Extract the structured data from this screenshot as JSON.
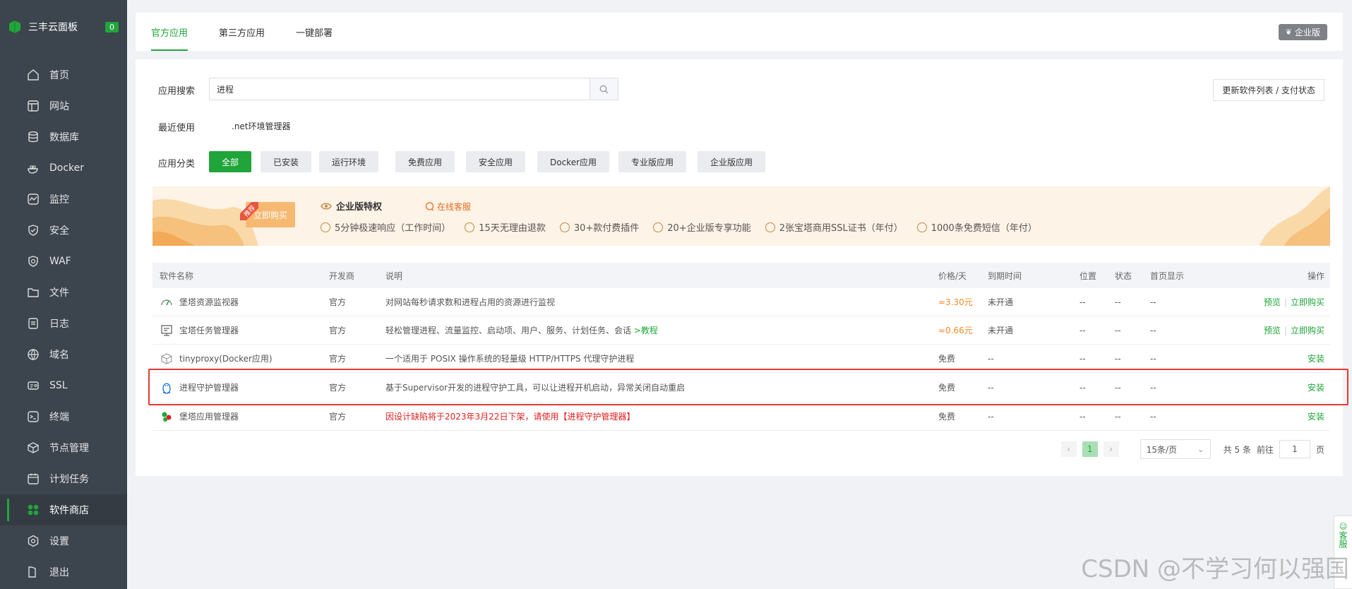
{
  "sidebar": {
    "brand": "三丰云面板",
    "badge": "0",
    "items": [
      {
        "label": "首页",
        "icon": "home-icon"
      },
      {
        "label": "网站",
        "icon": "website-icon"
      },
      {
        "label": "数据库",
        "icon": "database-icon"
      },
      {
        "label": "Docker",
        "icon": "docker-icon"
      },
      {
        "label": "监控",
        "icon": "monitor-icon"
      },
      {
        "label": "安全",
        "icon": "shield-icon"
      },
      {
        "label": "WAF",
        "icon": "waf-icon"
      },
      {
        "label": "文件",
        "icon": "folder-icon"
      },
      {
        "label": "日志",
        "icon": "log-icon"
      },
      {
        "label": "域名",
        "icon": "globe-icon"
      },
      {
        "label": "SSL",
        "icon": "ssl-icon"
      },
      {
        "label": "终端",
        "icon": "terminal-icon"
      },
      {
        "label": "节点管理",
        "icon": "cube-icon"
      },
      {
        "label": "计划任务",
        "icon": "calendar-icon"
      },
      {
        "label": "软件商店",
        "icon": "store-icon",
        "active": true
      },
      {
        "label": "设置",
        "icon": "gear-icon"
      },
      {
        "label": "退出",
        "icon": "logout-icon"
      }
    ]
  },
  "tabs": [
    {
      "label": "官方应用",
      "active": true
    },
    {
      "label": "第三方应用"
    },
    {
      "label": "一键部署"
    }
  ],
  "enterprise_button": "企业版",
  "search": {
    "label": "应用搜索",
    "value": "进程"
  },
  "update_button": "更新软件列表 / 支付状态",
  "recent": {
    "label": "最近使用",
    "item": ".net环境管理器"
  },
  "categories": {
    "label": "应用分类",
    "items": [
      "全部",
      "已安装",
      "运行环境",
      "免费应用",
      "安全应用",
      "Docker应用",
      "专业版应用",
      "企业版应用"
    ]
  },
  "banner": {
    "ribbon": "推荐",
    "buy": "立即购买",
    "title": "企业版特权",
    "support": "在线客服",
    "features": [
      "5分钟极速响应（工作时间）",
      "15天无理由退款",
      "30+款付费插件",
      "20+企业版专享功能",
      "2张宝塔商用SSL证书（年付）",
      "1000条免费短信（年付）"
    ]
  },
  "table": {
    "headers": [
      "软件名称",
      "开发商",
      "说明",
      "价格/天",
      "到期时间",
      "位置",
      "状态",
      "首页显示",
      "操作"
    ],
    "rows": [
      {
        "name": "堡塔资源监视器",
        "dev": "官方",
        "desc": "对网站每秒请求数和进程占用的资源进行监视",
        "desc_link": "",
        "price": "≈3.30元",
        "expire": "未开通",
        "pos": "--",
        "status": "--",
        "home": "--",
        "actions": [
          "预览",
          "立即购买"
        ],
        "icon": "gauge-icon",
        "warn": false
      },
      {
        "name": "宝塔任务管理器",
        "dev": "官方",
        "desc": "轻松管理进程、流量监控、启动项、用户、服务、计划任务、会话",
        "desc_link": ">教程",
        "price": "≈0.66元",
        "expire": "未开通",
        "pos": "--",
        "status": "--",
        "home": "--",
        "actions": [
          "预览",
          "立即购买"
        ],
        "icon": "task-manager-icon",
        "warn": false
      },
      {
        "name": "tinyproxy(Docker应用)",
        "dev": "官方",
        "desc": "一个适用于 POSIX 操作系统的轻量级 HTTP/HTTPS 代理守护进程",
        "desc_link": "",
        "price": "免费",
        "expire": "--",
        "pos": "--",
        "status": "--",
        "home": "--",
        "actions": [
          "安装"
        ],
        "icon": "box-icon",
        "warn": false
      },
      {
        "name": "进程守护管理器",
        "dev": "官方",
        "desc": "基于Supervisor开发的进程守护工具，可以让进程开机启动，异常关闭自动重启",
        "desc_link": "",
        "price": "免费",
        "expire": "--",
        "pos": "--",
        "status": "--",
        "home": "--",
        "actions": [
          "安装"
        ],
        "icon": "linux-penguin-icon",
        "warn": false
      },
      {
        "name": "堡塔应用管理器",
        "dev": "官方",
        "desc": "因设计缺陷将于2023年3月22日下架，请使用【进程守护管理器】",
        "desc_link": "",
        "price": "免费",
        "expire": "--",
        "pos": "--",
        "status": "--",
        "home": "--",
        "actions": [
          "安装"
        ],
        "icon": "app-manager-icon",
        "warn": true
      }
    ]
  },
  "pagination": {
    "current": "1",
    "page_size": "15条/页",
    "total": "共 5 条",
    "goto_label": "前往",
    "goto_value": "1",
    "page_suffix": "页"
  },
  "side_service": "客服",
  "watermark": "CSDN @不学习何以强国",
  "colors": {
    "accent": "#20a53a",
    "sidebar_bg": "#3c444d",
    "price": "#f08b25",
    "warning": "#e02020",
    "highlight_box": "#e53935"
  }
}
